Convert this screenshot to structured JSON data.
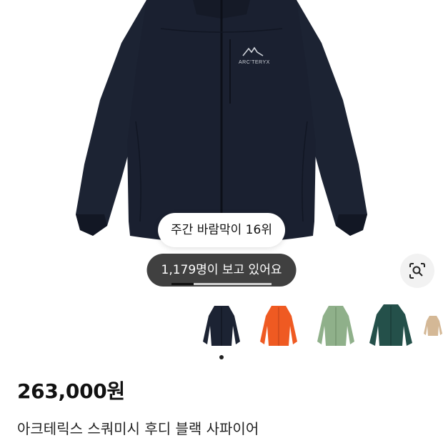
{
  "hero": {
    "rank_badge": "주간 바람막이 16위",
    "views_badge": "1,179명이 보고 있어요",
    "gallery_progress": 0.22,
    "brand_logo_text": "ARC'TERYX"
  },
  "colors": {
    "jacket_main": "#1c2333",
    "variants": [
      {
        "name": "black-sapphire",
        "color": "#1c2333"
      },
      {
        "name": "orange",
        "color": "#ef5a22"
      },
      {
        "name": "green",
        "color": "#8fb08a"
      },
      {
        "name": "dark-green",
        "color": "#24504a"
      },
      {
        "name": "beige",
        "color": "#d4b896"
      }
    ]
  },
  "product": {
    "price": "263,000원",
    "title": "아크테릭스 스쿼미시 후디 블랙 사파이어"
  }
}
